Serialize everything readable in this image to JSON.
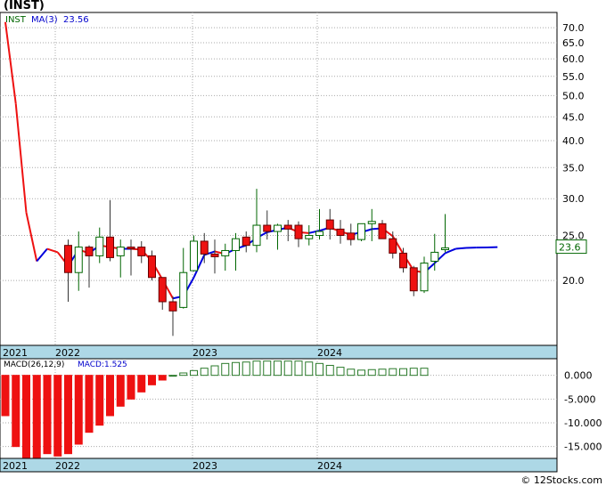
{
  "ticker_title": "(INST)",
  "price_legend": {
    "symbol": "INST",
    "ma_label": "MA(3)",
    "ma_value": "23.56"
  },
  "macd_legend": {
    "label": "MACD(26,12,9)",
    "value_label": "MACD:1.525"
  },
  "last_price_tag": "23.6",
  "credit": "© 12Stocks.com",
  "colors": {
    "up_candle": "#ffffff",
    "down_candle": "#ee1111",
    "candle_border": "#006600",
    "ma_up": "#0000dd",
    "ma_down": "#ee1111",
    "macd_pos": "#2a7a2a",
    "macd_neg": "#ee1111",
    "time_strip": "#add8e6"
  },
  "chart_data": [
    {
      "type": "candlestick",
      "title": "(INST)",
      "y_scale": "log",
      "ylim": [
        14.5,
        75.5
      ],
      "y_ticks": [
        "70.0",
        "65.0",
        "60.0",
        "55.0",
        "50.0",
        "45.0",
        "40.0",
        "35.0",
        "30.0",
        "25.0",
        "20.0"
      ],
      "x_labels": [
        "2021",
        "2022",
        "2023",
        "2024"
      ],
      "candles": [
        {
          "t": "2021-07",
          "o": 23.8,
          "h": 24.5,
          "l": 18.0,
          "c": 20.8
        },
        {
          "t": "2021-08",
          "o": 20.8,
          "h": 25.5,
          "l": 19.0,
          "c": 23.6
        },
        {
          "t": "2021-09",
          "o": 23.6,
          "h": 23.8,
          "l": 19.3,
          "c": 22.6
        },
        {
          "t": "2021-10",
          "o": 22.6,
          "h": 26.0,
          "l": 21.8,
          "c": 24.8
        },
        {
          "t": "2021-11",
          "o": 24.8,
          "h": 29.8,
          "l": 22.0,
          "c": 22.4
        },
        {
          "t": "2021-12",
          "o": 22.6,
          "h": 24.5,
          "l": 20.3,
          "c": 23.6
        },
        {
          "t": "2022-01",
          "o": 23.6,
          "h": 24.5,
          "l": 20.5,
          "c": 23.4
        },
        {
          "t": "2022-02",
          "o": 23.6,
          "h": 24.3,
          "l": 21.8,
          "c": 22.6
        },
        {
          "t": "2022-03",
          "o": 22.6,
          "h": 23.2,
          "l": 20.0,
          "c": 20.3
        },
        {
          "t": "2022-04",
          "o": 20.3,
          "h": 20.3,
          "l": 17.3,
          "c": 18.0
        },
        {
          "t": "2022-05",
          "o": 18.0,
          "h": 18.5,
          "l": 15.2,
          "c": 17.2
        },
        {
          "t": "2022-06",
          "o": 17.5,
          "h": 23.5,
          "l": 17.4,
          "c": 20.8
        },
        {
          "t": "2022-07",
          "o": 21.0,
          "h": 25.0,
          "l": 20.9,
          "c": 24.3
        },
        {
          "t": "2022-08",
          "o": 24.3,
          "h": 25.3,
          "l": 21.8,
          "c": 22.8
        },
        {
          "t": "2022-09",
          "o": 22.8,
          "h": 24.5,
          "l": 20.7,
          "c": 22.5
        },
        {
          "t": "2022-10",
          "o": 22.6,
          "h": 24.0,
          "l": 21.0,
          "c": 23.2
        },
        {
          "t": "2022-11",
          "o": 23.2,
          "h": 25.3,
          "l": 21.0,
          "c": 24.6
        },
        {
          "t": "2022-12",
          "o": 24.8,
          "h": 25.5,
          "l": 23.0,
          "c": 23.8
        },
        {
          "t": "2023-01",
          "o": 23.8,
          "h": 31.5,
          "l": 23.0,
          "c": 26.3
        },
        {
          "t": "2023-02",
          "o": 26.3,
          "h": 28.3,
          "l": 24.5,
          "c": 25.5
        },
        {
          "t": "2023-03",
          "o": 25.5,
          "h": 26.5,
          "l": 23.3,
          "c": 26.3
        },
        {
          "t": "2023-04",
          "o": 26.3,
          "h": 27.0,
          "l": 24.3,
          "c": 25.8
        },
        {
          "t": "2023-05",
          "o": 26.3,
          "h": 26.8,
          "l": 23.6,
          "c": 24.6
        },
        {
          "t": "2023-06",
          "o": 24.6,
          "h": 26.3,
          "l": 23.8,
          "c": 25.0
        },
        {
          "t": "2023-07",
          "o": 25.0,
          "h": 28.5,
          "l": 24.5,
          "c": 25.5
        },
        {
          "t": "2023-08",
          "o": 27.0,
          "h": 28.5,
          "l": 24.5,
          "c": 25.8
        },
        {
          "t": "2023-09",
          "o": 25.8,
          "h": 27.0,
          "l": 24.0,
          "c": 25.0
        },
        {
          "t": "2023-10",
          "o": 25.3,
          "h": 26.5,
          "l": 23.8,
          "c": 24.5
        },
        {
          "t": "2023-11",
          "o": 24.5,
          "h": 26.5,
          "l": 24.3,
          "c": 26.5
        },
        {
          "t": "2023-12",
          "o": 26.5,
          "h": 28.5,
          "l": 24.3,
          "c": 26.8
        },
        {
          "t": "2024-01",
          "o": 26.5,
          "h": 27.0,
          "l": 24.6,
          "c": 24.6
        },
        {
          "t": "2024-02",
          "o": 24.6,
          "h": 25.5,
          "l": 22.3,
          "c": 22.9
        },
        {
          "t": "2024-03",
          "o": 22.9,
          "h": 23.5,
          "l": 20.8,
          "c": 21.3
        },
        {
          "t": "2024-04",
          "o": 21.3,
          "h": 21.5,
          "l": 18.5,
          "c": 19.0
        },
        {
          "t": "2024-05",
          "o": 19.0,
          "h": 22.5,
          "l": 18.8,
          "c": 21.8
        },
        {
          "t": "2024-06",
          "o": 22.0,
          "h": 25.2,
          "l": 21.0,
          "c": 23.0
        },
        {
          "t": "2024-07",
          "o": 23.3,
          "h": 27.8,
          "l": 23.0,
          "c": 23.5
        }
      ],
      "ma_series": [
        {
          "t": "2021-01",
          "v": 72.0
        },
        {
          "t": "2021-02",
          "v": 48.0
        },
        {
          "t": "2021-03",
          "v": 28.0
        },
        {
          "t": "2021-04",
          "v": 22.0
        },
        {
          "t": "2021-05",
          "v": 23.4
        },
        {
          "t": "2021-06",
          "v": 23.0
        },
        {
          "t": "2021-07",
          "v": 21.5
        },
        {
          "t": "2021-08",
          "v": 23.3
        },
        {
          "t": "2021-09",
          "v": 22.9
        },
        {
          "t": "2021-10",
          "v": 23.8
        },
        {
          "t": "2021-11",
          "v": 23.6
        },
        {
          "t": "2021-12",
          "v": 23.4
        },
        {
          "t": "2022-01",
          "v": 23.4
        },
        {
          "t": "2022-02",
          "v": 23.3
        },
        {
          "t": "2022-03",
          "v": 22.0
        },
        {
          "t": "2022-04",
          "v": 20.1
        },
        {
          "t": "2022-05",
          "v": 18.3
        },
        {
          "t": "2022-06",
          "v": 18.5
        },
        {
          "t": "2022-07",
          "v": 20.3
        },
        {
          "t": "2022-08",
          "v": 22.7
        },
        {
          "t": "2022-09",
          "v": 23.1
        },
        {
          "t": "2022-10",
          "v": 22.8
        },
        {
          "t": "2022-11",
          "v": 23.4
        },
        {
          "t": "2022-12",
          "v": 23.8
        },
        {
          "t": "2023-01",
          "v": 24.7
        },
        {
          "t": "2023-02",
          "v": 25.4
        },
        {
          "t": "2023-03",
          "v": 25.7
        },
        {
          "t": "2023-04",
          "v": 26.0
        },
        {
          "t": "2023-05",
          "v": 25.4
        },
        {
          "t": "2023-06",
          "v": 25.3
        },
        {
          "t": "2023-07",
          "v": 25.6
        },
        {
          "t": "2023-08",
          "v": 26.0
        },
        {
          "t": "2023-09",
          "v": 25.5
        },
        {
          "t": "2023-10",
          "v": 25.1
        },
        {
          "t": "2023-11",
          "v": 25.4
        },
        {
          "t": "2023-12",
          "v": 25.8
        },
        {
          "t": "2024-01",
          "v": 25.9
        },
        {
          "t": "2024-02",
          "v": 24.9
        },
        {
          "t": "2024-03",
          "v": 22.8
        },
        {
          "t": "2024-04",
          "v": 21.0
        },
        {
          "t": "2024-05",
          "v": 20.8
        },
        {
          "t": "2024-06",
          "v": 21.8
        },
        {
          "t": "2024-07",
          "v": 22.9
        },
        {
          "t": "2024-08",
          "v": 23.4
        },
        {
          "t": "2024-09",
          "v": 23.5
        },
        {
          "t": "2024-10",
          "v": 23.55
        },
        {
          "t": "2024-11",
          "v": 23.56
        },
        {
          "t": "2024-12",
          "v": 23.6
        }
      ],
      "last_price": 23.6
    },
    {
      "type": "bar",
      "title": "MACD(26,12,9)",
      "ylim": [
        -17500,
        3500
      ],
      "y_ticks": [
        "0.000",
        "-5.000",
        "-10.000",
        "-15.000"
      ],
      "x_labels": [
        "2021",
        "2022",
        "2023",
        "2024"
      ],
      "values": [
        -8500,
        -15000,
        -19000,
        -17500,
        -16500,
        -17000,
        -16500,
        -14500,
        -12000,
        -10500,
        -8500,
        -6500,
        -5000,
        -3500,
        -2000,
        -1000,
        0,
        500,
        1000,
        1500,
        2000,
        2500,
        2700,
        2800,
        3000,
        3000,
        3000,
        3000,
        3000,
        2800,
        2500,
        2100,
        1700,
        1300,
        1100,
        1200,
        1300,
        1400,
        1400,
        1500,
        1500
      ]
    }
  ]
}
